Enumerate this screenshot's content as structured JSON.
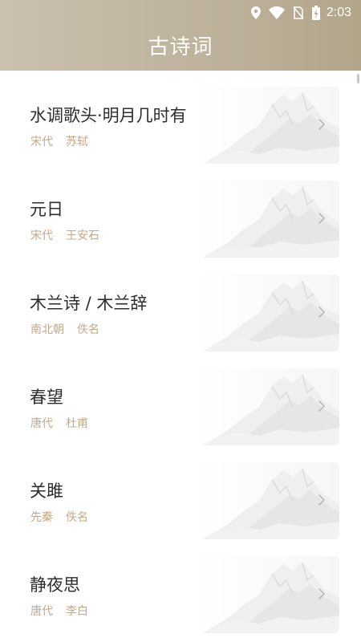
{
  "status_bar": {
    "time": "2:03",
    "icons": [
      "location-icon",
      "wifi-icon",
      "no-sim-icon",
      "battery-charging-icon"
    ]
  },
  "header": {
    "title": "古诗词"
  },
  "colors": {
    "header_gradient": [
      "#c9c0ae",
      "#b1a58a"
    ],
    "title_text": "#2d2d2d",
    "meta_text": "#c4a888",
    "chevron": "#b8b8b8"
  },
  "poems": [
    {
      "title": "水调歌头·明月几时有",
      "dynasty": "宋代",
      "author": "苏轼"
    },
    {
      "title": "元日",
      "dynasty": "宋代",
      "author": "王安石"
    },
    {
      "title": "木兰诗 / 木兰辞",
      "dynasty": "南北朝",
      "author": "佚名"
    },
    {
      "title": "春望",
      "dynasty": "唐代",
      "author": "杜甫"
    },
    {
      "title": "关雎",
      "dynasty": "先秦",
      "author": "佚名"
    },
    {
      "title": "静夜思",
      "dynasty": "唐代",
      "author": "李白"
    }
  ]
}
